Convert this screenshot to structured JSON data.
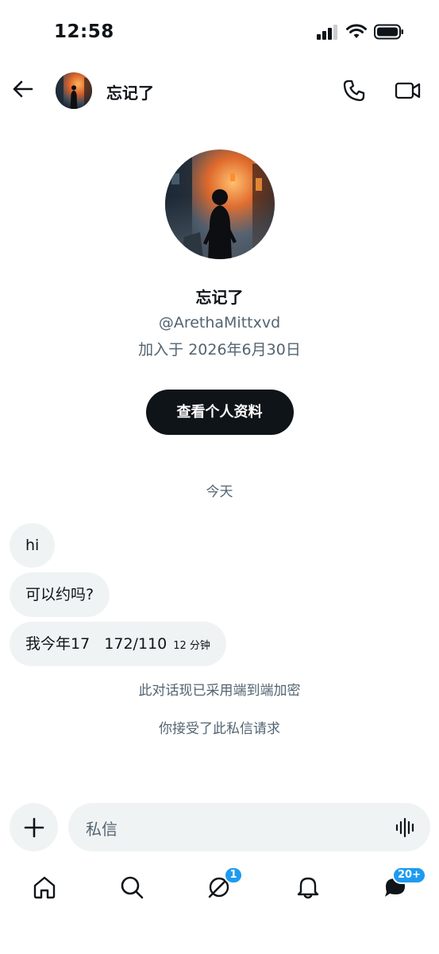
{
  "status_bar": {
    "time": "12:58"
  },
  "header": {
    "contact_name": "忘记了"
  },
  "profile": {
    "name": "忘记了",
    "handle": "@ArethaMittxvd",
    "joined": "加入于 2026年6月30日",
    "view_profile_label": "查看个人资料"
  },
  "conversation": {
    "date_separator": "今天",
    "messages": [
      {
        "text": "hi"
      },
      {
        "text": "可以约吗?"
      },
      {
        "text": "我今年17   172/110",
        "time": "12 分钟"
      }
    ],
    "encryption_note": "此对话现已采用端到端加密",
    "accepted_note": "你接受了此私信请求"
  },
  "composer": {
    "placeholder": "私信"
  },
  "bottom_nav": {
    "items": [
      {
        "icon": "home-icon"
      },
      {
        "icon": "search-icon"
      },
      {
        "icon": "grok-icon",
        "badge": "1"
      },
      {
        "icon": "bell-icon"
      },
      {
        "icon": "messages-icon",
        "badge": "20+"
      }
    ]
  },
  "colors": {
    "text": "#0f1419",
    "secondary_text": "#536471",
    "bubble": "#eff3f4",
    "accent": "#1d9bf0",
    "button_bg": "#0f1419"
  }
}
